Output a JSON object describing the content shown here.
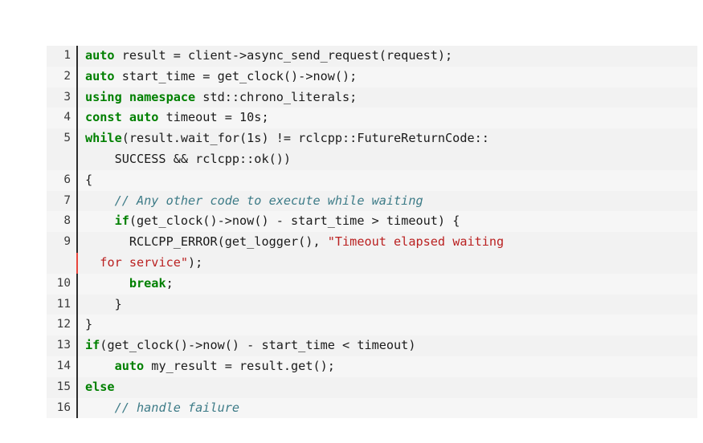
{
  "code_listing": {
    "language": "cpp",
    "colors": {
      "background": "#f2f2f2",
      "background_alt": "#f6f6f6",
      "keyword": "#008000",
      "string": "#ba2121",
      "comment": "#3d7b87",
      "text": "#1b1b1b",
      "gutter_bar": "#2b2b2b",
      "gutter_marker": "#e8453c",
      "line_number": "#3b3b3b"
    },
    "rows": [
      {
        "number": "1",
        "marked": false,
        "alt": false,
        "tokens": [
          {
            "t": "auto",
            "c": "kw"
          },
          {
            "t": " result = client->async_send_request(request);",
            "c": "plain"
          }
        ]
      },
      {
        "number": "2",
        "marked": false,
        "alt": true,
        "tokens": [
          {
            "t": "auto",
            "c": "kw"
          },
          {
            "t": " start_time = get_clock()->now();",
            "c": "plain"
          }
        ]
      },
      {
        "number": "3",
        "marked": false,
        "alt": false,
        "tokens": [
          {
            "t": "using namespace",
            "c": "kw"
          },
          {
            "t": " std::chrono_literals;",
            "c": "plain"
          }
        ]
      },
      {
        "number": "4",
        "marked": false,
        "alt": true,
        "tokens": [
          {
            "t": "const auto",
            "c": "kw"
          },
          {
            "t": " timeout = 10s;",
            "c": "plain"
          }
        ]
      },
      {
        "number": "5",
        "marked": false,
        "alt": false,
        "tokens": [
          {
            "t": "while",
            "c": "kw"
          },
          {
            "t": "(result.wait_for(1s) != rclcpp::FutureReturnCode::",
            "c": "plain"
          }
        ]
      },
      {
        "number": "",
        "marked": false,
        "alt": false,
        "tokens": [
          {
            "t": "    SUCCESS && rclcpp::ok())",
            "c": "plain"
          }
        ]
      },
      {
        "number": "6",
        "marked": false,
        "alt": true,
        "tokens": [
          {
            "t": "{",
            "c": "plain"
          }
        ]
      },
      {
        "number": "7",
        "marked": false,
        "alt": false,
        "tokens": [
          {
            "t": "    ",
            "c": "plain"
          },
          {
            "t": "// Any other code to execute while waiting",
            "c": "cmt"
          }
        ]
      },
      {
        "number": "8",
        "marked": false,
        "alt": true,
        "tokens": [
          {
            "t": "    ",
            "c": "plain"
          },
          {
            "t": "if",
            "c": "kw"
          },
          {
            "t": "(get_clock()->now() - start_time > timeout) {",
            "c": "plain"
          }
        ]
      },
      {
        "number": "9",
        "marked": false,
        "alt": false,
        "tokens": [
          {
            "t": "      RCLCPP_ERROR(get_logger(), ",
            "c": "plain"
          },
          {
            "t": "\"Timeout elapsed waiting",
            "c": "str"
          }
        ]
      },
      {
        "number": "",
        "marked": true,
        "alt": false,
        "tokens": [
          {
            "t": "  ",
            "c": "plain"
          },
          {
            "t": "for service\"",
            "c": "str"
          },
          {
            "t": ");",
            "c": "plain"
          }
        ]
      },
      {
        "number": "10",
        "marked": false,
        "alt": true,
        "tokens": [
          {
            "t": "      ",
            "c": "plain"
          },
          {
            "t": "break",
            "c": "kw"
          },
          {
            "t": ";",
            "c": "plain"
          }
        ]
      },
      {
        "number": "11",
        "marked": false,
        "alt": false,
        "tokens": [
          {
            "t": "    }",
            "c": "plain"
          }
        ]
      },
      {
        "number": "12",
        "marked": false,
        "alt": true,
        "tokens": [
          {
            "t": "}",
            "c": "plain"
          }
        ]
      },
      {
        "number": "13",
        "marked": false,
        "alt": false,
        "tokens": [
          {
            "t": "if",
            "c": "kw"
          },
          {
            "t": "(get_clock()->now() - start_time < timeout)",
            "c": "plain"
          }
        ]
      },
      {
        "number": "14",
        "marked": false,
        "alt": true,
        "tokens": [
          {
            "t": "    ",
            "c": "plain"
          },
          {
            "t": "auto",
            "c": "kw"
          },
          {
            "t": " my_result = result.get();",
            "c": "plain"
          }
        ]
      },
      {
        "number": "15",
        "marked": false,
        "alt": false,
        "tokens": [
          {
            "t": "else",
            "c": "kw"
          }
        ]
      },
      {
        "number": "16",
        "marked": false,
        "alt": true,
        "tokens": [
          {
            "t": "    ",
            "c": "plain"
          },
          {
            "t": "// handle failure",
            "c": "cmt"
          }
        ]
      }
    ]
  }
}
